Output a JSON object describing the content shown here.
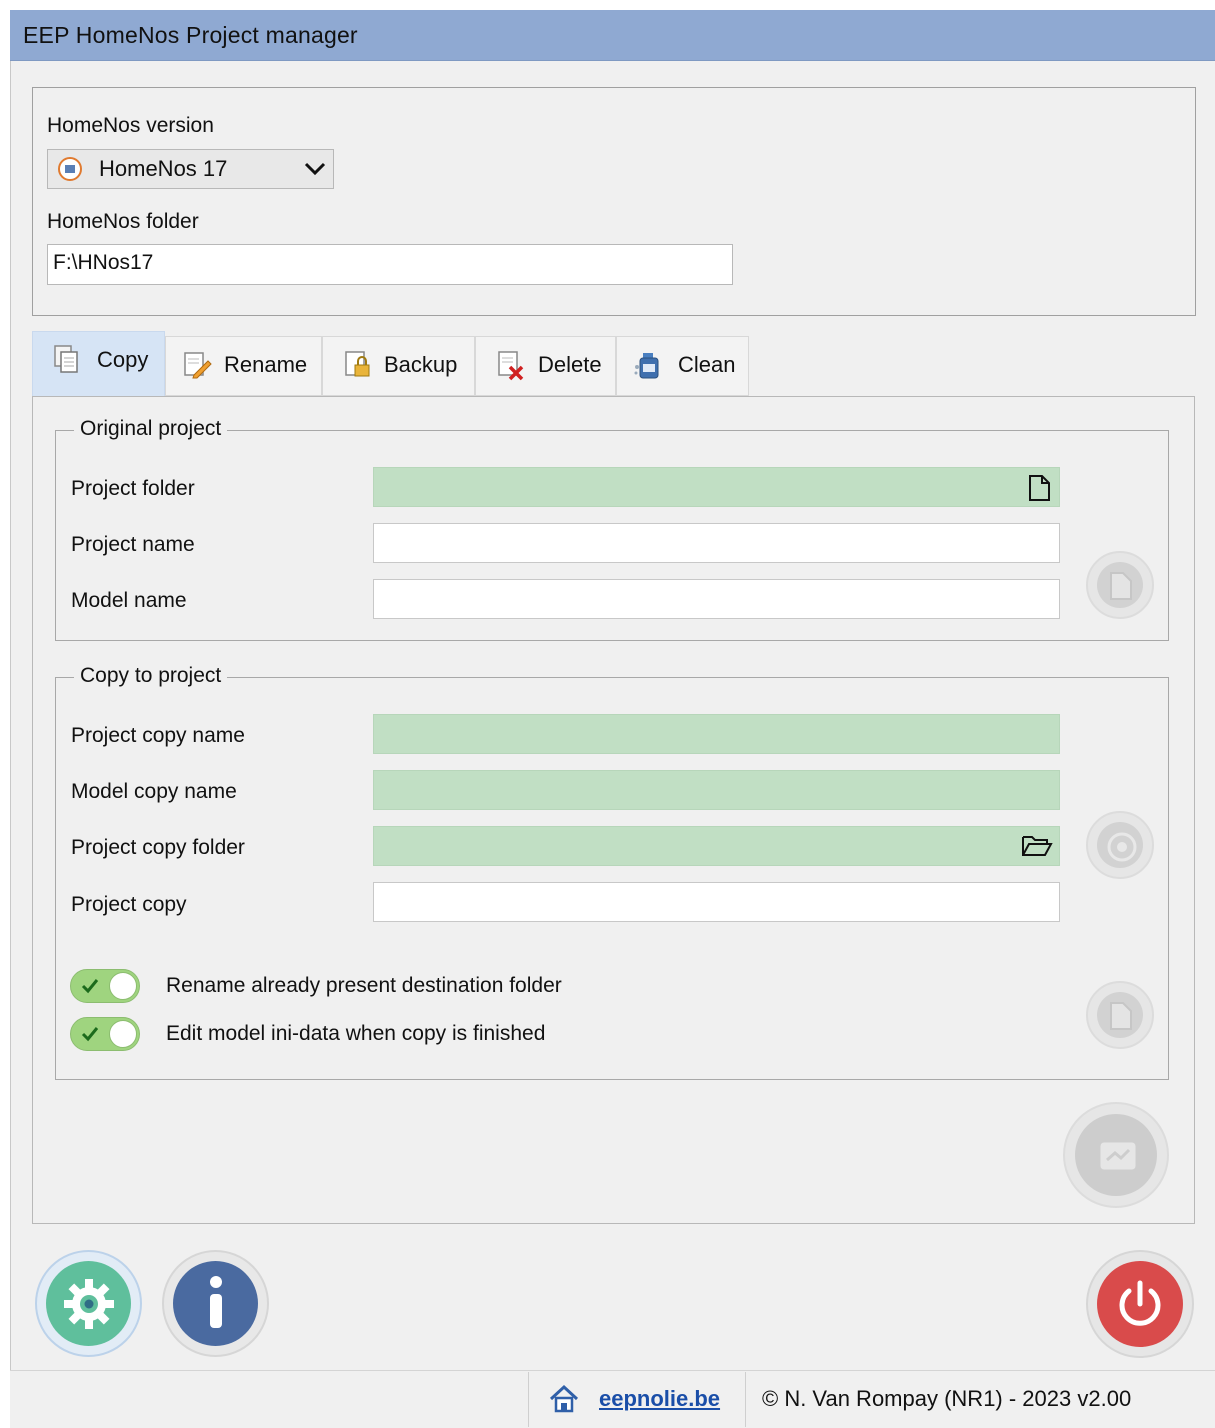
{
  "window": {
    "title": "EEP HomeNos Project manager"
  },
  "version_section": {
    "version_label": "HomeNos version",
    "version_selected": "HomeNos 17",
    "folder_label": "HomeNos folder",
    "folder_value": "F:\\HNos17"
  },
  "tabs": [
    {
      "label": "Copy",
      "icon": "copy-icon",
      "active": true
    },
    {
      "label": "Rename",
      "icon": "rename-icon",
      "active": false
    },
    {
      "label": "Backup",
      "icon": "backup-icon",
      "active": false
    },
    {
      "label": "Delete",
      "icon": "delete-icon",
      "active": false
    },
    {
      "label": "Clean",
      "icon": "clean-icon",
      "active": false
    }
  ],
  "original_project": {
    "legend": "Original project",
    "project_folder_label": "Project folder",
    "project_name_label": "Project name",
    "model_name_label": "Model name",
    "project_folder_value": "",
    "project_name_value": "",
    "model_name_value": ""
  },
  "copy_to_project": {
    "legend": "Copy to project",
    "project_copy_name_label": "Project copy name",
    "model_copy_name_label": "Model copy name",
    "project_copy_folder_label": "Project copy folder",
    "project_copy_label": "Project copy",
    "toggle_rename_label": "Rename already present destination folder",
    "toggle_edit_label": "Edit model ini-data when copy is finished",
    "toggle_rename_on": true,
    "toggle_edit_on": true
  },
  "footer": {
    "link_text": "eepnolie.be",
    "copyright": "© N. Van Rompay (NR1) - 2023 v2.00"
  },
  "colors": {
    "title_bar": "#8fa9d2",
    "field_required": "#c1dfc4",
    "settings_button": "#5fbf9c",
    "info_button": "#4a6aa0",
    "power_button": "#d94b4b",
    "toggle_on": "#9fd47f"
  }
}
